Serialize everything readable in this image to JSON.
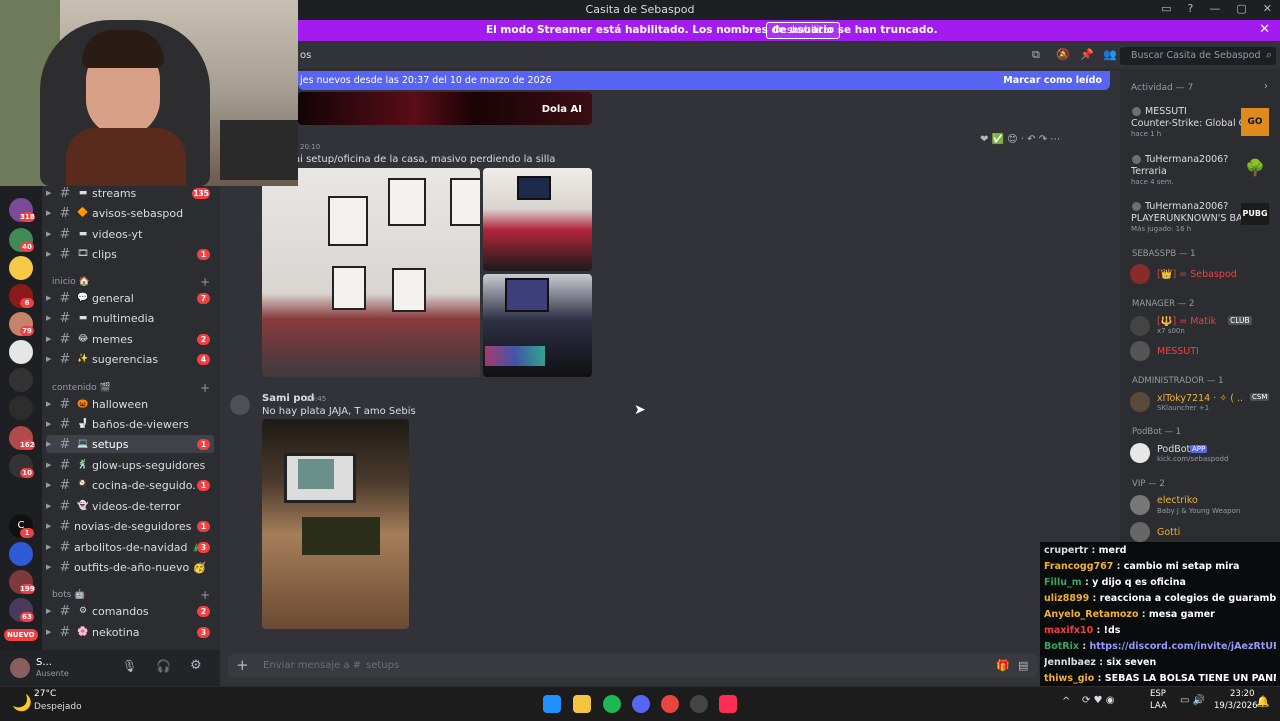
{
  "window": {
    "title": "Casita de Sebaspod"
  },
  "banner": {
    "text": "El modo Streamer está habilitado. Los nombres de usuario se han truncado.",
    "button": "Deshabilitar"
  },
  "chat_header": {
    "title": "os",
    "search_placeholder": "Buscar Casita de Sebaspod"
  },
  "new_messages": {
    "text": "jes nuevos desde las 20:37 del 10 de marzo de 2026",
    "action": "Marcar como leído"
  },
  "servers": [
    {
      "badge": "318"
    },
    {
      "badge": "40"
    },
    {
      "badge": ""
    },
    {
      "badge": "6"
    },
    {
      "badge": "79"
    },
    {
      "badge": ""
    },
    {
      "badge": ""
    },
    {
      "badge": "162"
    },
    {
      "badge": "10"
    },
    {
      "badge": ""
    },
    {
      "badge": "1"
    },
    {
      "badge": ""
    },
    {
      "badge": "199"
    },
    {
      "badge": "63"
    }
  ],
  "server_new_label": "NUEVO",
  "channels": [
    {
      "emoji": "▬",
      "name": "streams",
      "count": "135"
    },
    {
      "emoji": "🔶",
      "name": "avisos-sebaspod",
      "count": ""
    },
    {
      "emoji": "▬",
      "name": "videos-yt",
      "count": ""
    },
    {
      "emoji": "🎞",
      "name": "clips",
      "count": "1"
    }
  ],
  "categories": {
    "inicio": "inicio",
    "contenido": "contenido",
    "bots": "bots"
  },
  "channels_inicio": [
    {
      "emoji": "💬",
      "name": "general",
      "count": "7"
    },
    {
      "emoji": "▬",
      "name": "multimedia",
      "count": ""
    },
    {
      "emoji": "😂",
      "name": "memes",
      "count": "2"
    },
    {
      "emoji": "✨",
      "name": "sugerencias",
      "count": "4"
    }
  ],
  "channels_contenido": [
    {
      "emoji": "🎃",
      "name": "halloween",
      "count": "",
      "active": false
    },
    {
      "emoji": "🚽",
      "name": "baños-de-viewers",
      "count": "",
      "active": false
    },
    {
      "emoji": "💻",
      "name": "setups",
      "count": "1",
      "active": true
    },
    {
      "emoji": "🕺",
      "name": "glow-ups-seguidores",
      "count": "",
      "active": false
    },
    {
      "emoji": "🍳",
      "name": "cocina-de-seguido...",
      "count": "1",
      "active": false
    },
    {
      "emoji": "👻",
      "name": "videos-de-terror",
      "count": "",
      "active": false
    },
    {
      "emoji": "",
      "name": "novias-de-seguidores",
      "count": "1",
      "active": false
    },
    {
      "emoji": "",
      "name": "arbolitos-de-navidad 🎄",
      "count": "3",
      "active": false
    },
    {
      "emoji": "",
      "name": "outfits-de-año-nuevo 🥳",
      "count": "",
      "active": false
    }
  ],
  "channels_bots": [
    {
      "emoji": "⚙",
      "name": "comandos",
      "count": "2"
    },
    {
      "emoji": "🌸",
      "name": "nekotina",
      "count": "3"
    }
  ],
  "user": {
    "name": "S...",
    "status": "Ausente"
  },
  "messages": [
    {
      "time": "20:10",
      "text": "ai setup/oficina de la casa, masivo perdiendo la silla"
    },
    {
      "author": "Sami pod",
      "time": "20:45",
      "text": "No hay plata JAJA, T amo Sebis"
    }
  ],
  "embed_label": "Dola AI",
  "composer": {
    "placeholder": "Enviar mensaje a #",
    "channel": "setups"
  },
  "activity": {
    "header": "Actividad — 7",
    "items": [
      {
        "user": "MESSUTI",
        "game": "Counter-Strike: Global Off...",
        "time": "hace 1 h",
        "color": "#f23f43",
        "icon": "GO"
      },
      {
        "user": "TuHermana2006?",
        "game": "Terraria",
        "time": "hace 4 sem.",
        "color": "#3ba55d",
        "icon": "🌳"
      },
      {
        "user": "TuHermana2006?",
        "game": "PLAYERUNKNOWN'S BAT...",
        "time": "Más jugado: 16 h",
        "color": "#3ba55d",
        "icon": "PUBG"
      }
    ]
  },
  "member_groups": [
    {
      "label": "SEBASSPB — 1",
      "members": [
        {
          "name": "[👑] = Sebaspod",
          "sub": "",
          "color": "#f23f43",
          "tag": ""
        }
      ]
    },
    {
      "label": "MANAGER — 2",
      "members": [
        {
          "name": "[🔱] = Matik",
          "sub": "x7 s00n",
          "color": "#f23f43",
          "tag": "CLUB"
        },
        {
          "name": "MESSUTI",
          "sub": "",
          "color": "#f23f43",
          "tag": ""
        }
      ]
    },
    {
      "label": "ADMINISTRADOR — 1",
      "members": [
        {
          "name": "xlToky7214 · ✧ ( ...",
          "sub": "SKlauncher +1",
          "color": "#f0b232",
          "tag": "CSM"
        }
      ]
    },
    {
      "label": "PodBot — 1",
      "members": [
        {
          "name": "PodBot",
          "sub": "kick.com/sebaspodd",
          "color": "#dbdee1",
          "tag": "APP"
        }
      ]
    },
    {
      "label": "VIP — 2",
      "members": [
        {
          "name": "electriko",
          "sub": "Baby J & Young Weapon",
          "color": "#f0b232",
          "tag": ""
        },
        {
          "name": "Gotti",
          "sub": "",
          "color": "#f0b232",
          "tag": ""
        }
      ]
    }
  ],
  "stream_chat": [
    {
      "user": "crupertr",
      "msg": "merd",
      "color": "#dbdee1"
    },
    {
      "user": "Francogg767",
      "msg": "cambio mi setap mira",
      "color": "#f0b232"
    },
    {
      "user": "Fillu_m",
      "msg": "y dijo q es oficina",
      "color": "#3ba55d"
    },
    {
      "user": "uliz8899",
      "msg": "reacciona a colegios de guarambare",
      "color": "#f0b232"
    },
    {
      "user": "Anyelo_Retamozo",
      "msg": "mesa gamer",
      "color": "#f0b232"
    },
    {
      "user": "maxifx10",
      "msg": "!ds",
      "color": "#f23f43"
    },
    {
      "user": "BotRix",
      "msg": "https://discord.com/invite/jAezRtUFBa",
      "color": "#3ba55d"
    },
    {
      "user": "Jennlbaez",
      "msg": "six seven",
      "color": "#dbdee1"
    },
    {
      "user": "thiws_gio",
      "msg": "SEBAS LA BOLSA TIENE UN PANNNM",
      "color": "#f0b232"
    }
  ],
  "weather": {
    "temp": "27°C",
    "desc": "Despejado"
  },
  "clock": {
    "time": "23:20",
    "date": "19/3/2026",
    "lang": "ESP",
    "region": "LAA"
  }
}
